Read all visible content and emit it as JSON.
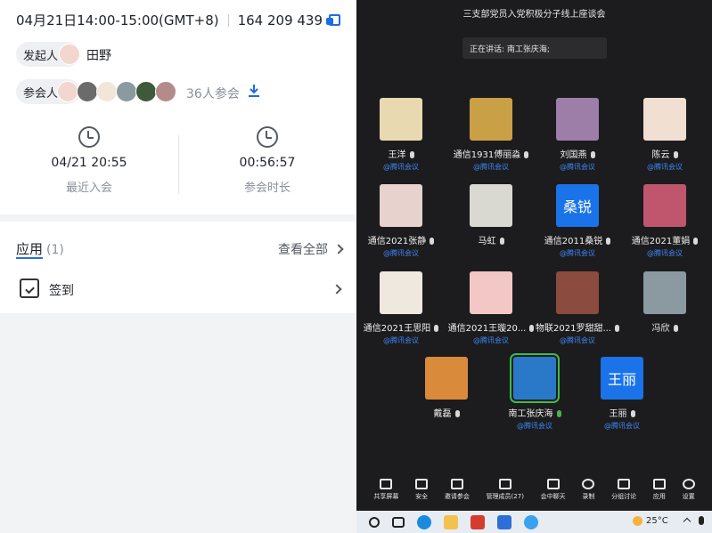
{
  "meeting": {
    "time_text": "04月21日14:00-15:00(GMT+8)",
    "meeting_id": "164 209 439"
  },
  "host": {
    "label": "发起人",
    "name": "田野"
  },
  "attendees": {
    "label": "参会人",
    "count_text": "36人参会"
  },
  "stats": {
    "last_join": {
      "value": "04/21 20:55",
      "label": "最近入会"
    },
    "duration": {
      "value": "00:56:57",
      "label": "参会时长"
    }
  },
  "apps": {
    "title": "应用",
    "count": "(1)",
    "view_all": "查看全部",
    "items": [
      {
        "label": "签到"
      }
    ]
  },
  "conference": {
    "title": "三支部党员入党积极分子线上座谈会",
    "speaking": "正在讲话: 南工张庆海;",
    "participants": [
      {
        "name": "王洋",
        "via": "@腾讯会议",
        "color": "#e8d9b0"
      },
      {
        "name": "通信1931傅丽淼",
        "via": "@腾讯会议",
        "color": "#c9a046"
      },
      {
        "name": "刘国燕",
        "via": "@腾讯会议",
        "color": "#9d7ea8"
      },
      {
        "name": "陈云",
        "via": "@腾讯会议",
        "color": "#f1dfd2"
      },
      {
        "name": "通信2021张静",
        "via": "@腾讯会议",
        "color": "#e7d2cd"
      },
      {
        "name": "马虹",
        "via": "",
        "color": "#d9d9d2"
      },
      {
        "name": "通信2011桑锐",
        "via": "@腾讯会议",
        "word": "桑锐"
      },
      {
        "name": "通信2021董娟",
        "via": "@腾讯会议",
        "color": "#c0566d"
      },
      {
        "name": "通信2021王思阳",
        "via": "@腾讯会议",
        "color": "#efe8df"
      },
      {
        "name": "通信2021王璇20...",
        "via": "@腾讯会议",
        "color": "#f3c7c5"
      },
      {
        "name": "物联2021罗甜甜...",
        "via": "@腾讯会议",
        "color": "#8b4b3e"
      },
      {
        "name": "冯欣",
        "via": "",
        "color": "#8a9aa0"
      },
      {
        "name": "戴磊",
        "via": "",
        "color": "#d98a3b"
      },
      {
        "name": "南工张庆海",
        "via": "@腾讯会议",
        "color": "#2a79c9",
        "highlight": true
      },
      {
        "name": "王丽",
        "via": "@腾讯会议",
        "word": "王丽"
      }
    ],
    "toolbar": [
      "共享屏幕",
      "安全",
      "邀请参会",
      "管理成员(27)",
      "会中聊天",
      "录制",
      "分组讨论",
      "应用",
      "设置"
    ]
  },
  "taskbar": {
    "weather": "25°C"
  }
}
